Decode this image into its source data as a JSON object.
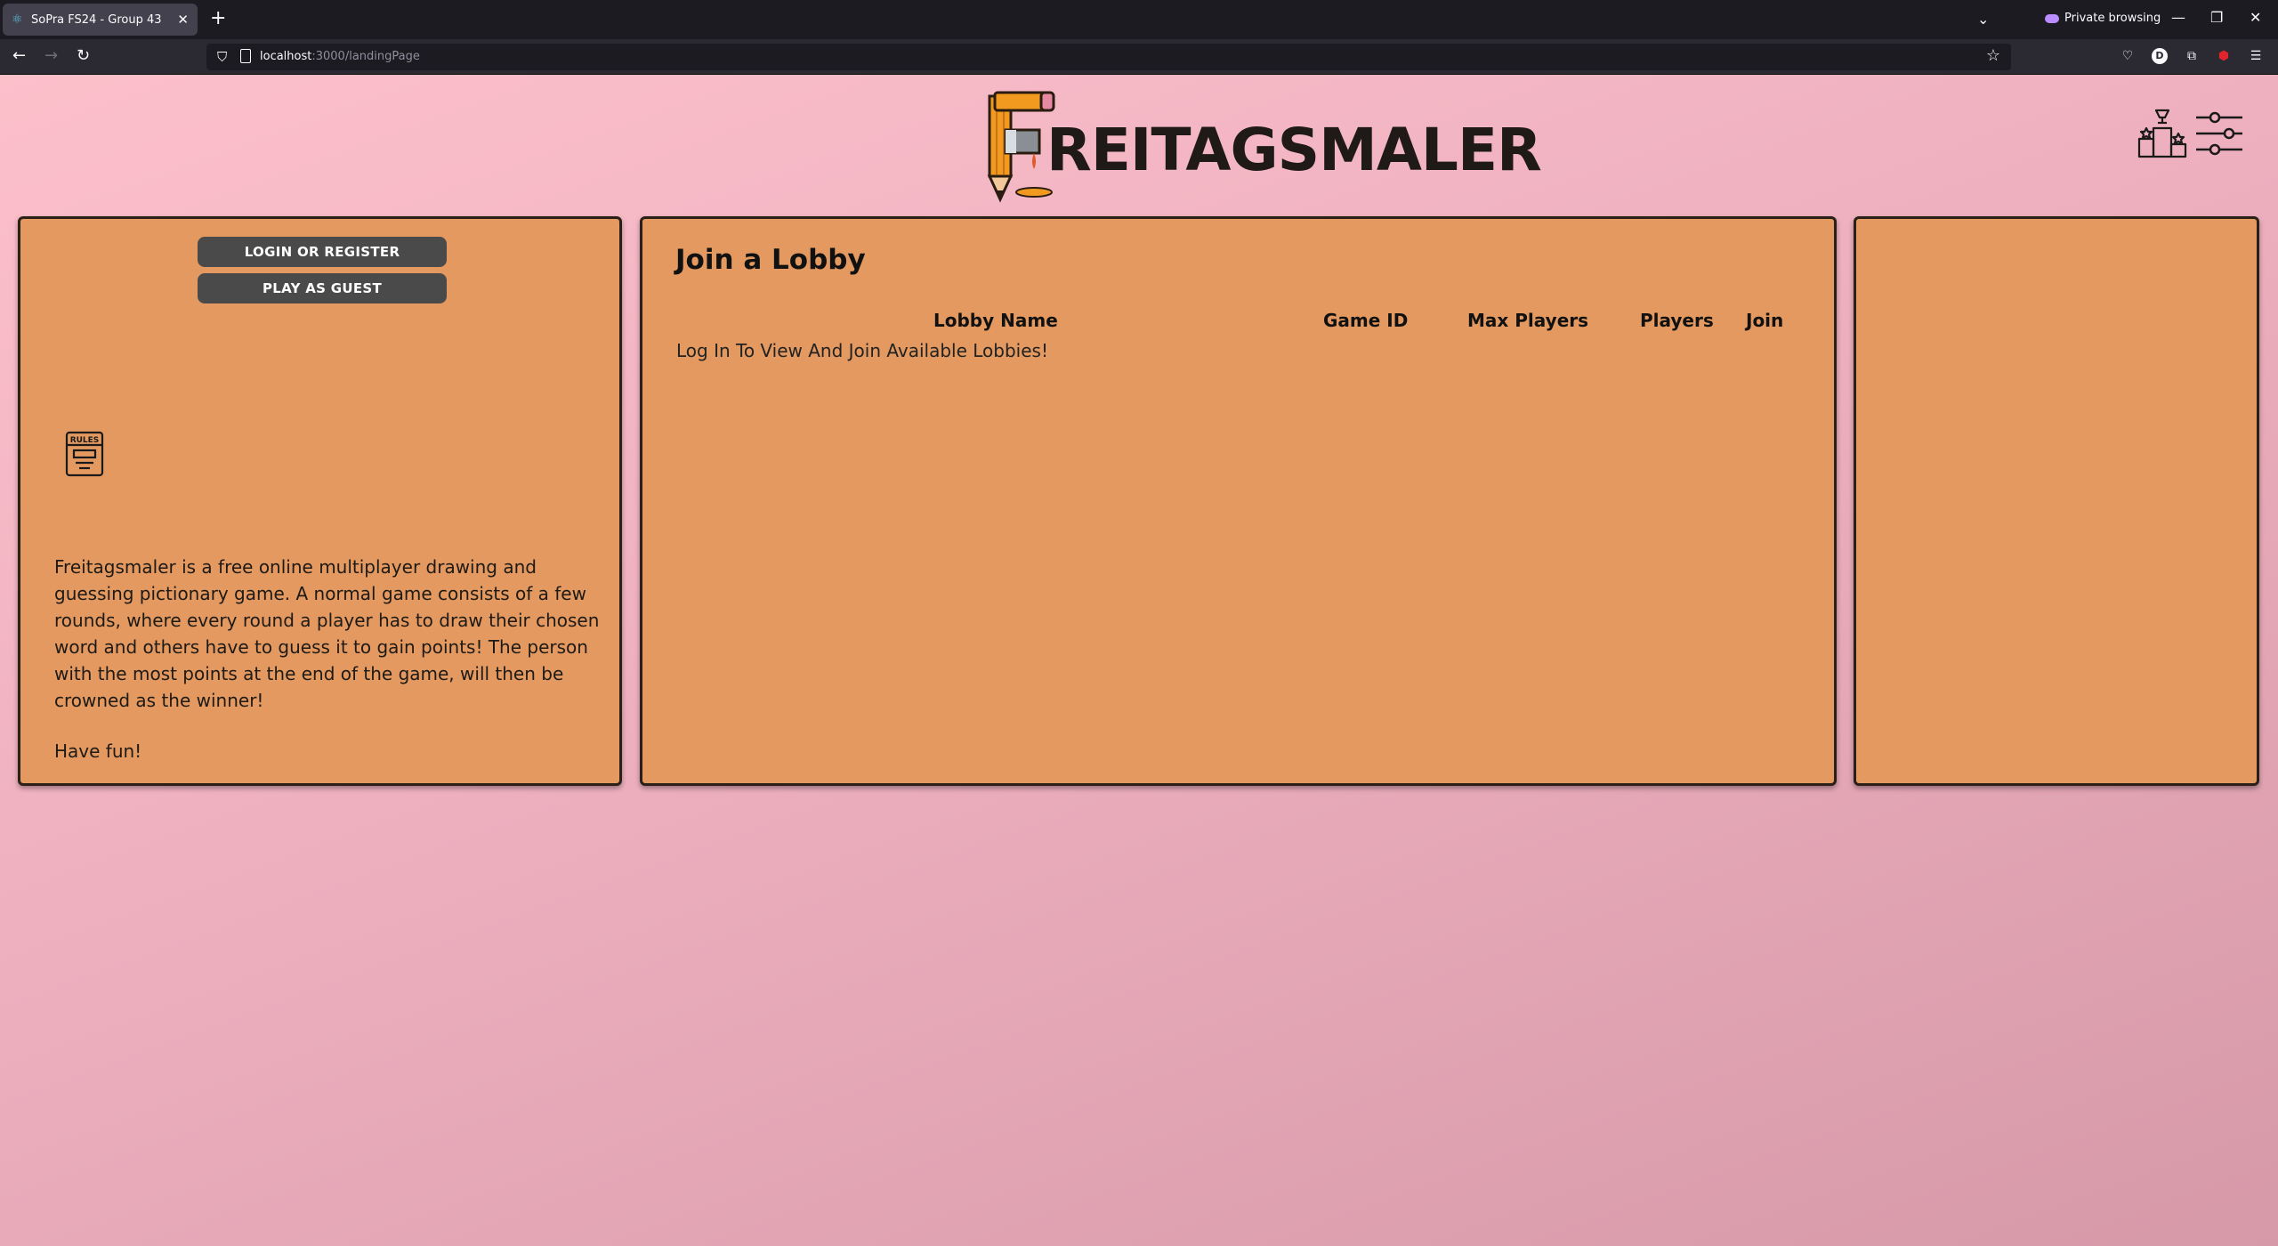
{
  "browser": {
    "tab_title": "SoPra FS24 - Group 43",
    "private_label": "Private browsing",
    "url_host": "localhost",
    "url_path": ":3000/landingPage"
  },
  "header": {
    "logo_text": "REITAGSMALER"
  },
  "left_panel": {
    "login_button": "LOGIN OR REGISTER",
    "guest_button": "PLAY AS GUEST",
    "rules_icon_label": "RULES",
    "description": "Freitagsmaler is a free online multiplayer drawing and guessing pictionary game. A normal game consists of a few rounds, where every round a player has to draw their chosen word and others have to guess it to gain points! The person with the most points at the end of the game, will then be crowned as the winner!",
    "sign_off": "Have fun!"
  },
  "lobby_panel": {
    "title": "Join a Lobby",
    "columns": [
      "Lobby Name",
      "Game ID",
      "Max Players",
      "Players",
      "Join"
    ],
    "empty_message": "Log In To View And Join Available Lobbies!"
  },
  "colors": {
    "background_start": "#fdc1cc",
    "background_end": "#d699a8",
    "panel": "#e3995f",
    "button": "#4a4a4a"
  },
  "icons": {
    "leaderboard": "podium-trophy-icon",
    "settings": "sliders-icon",
    "rules": "rules-book-icon"
  }
}
